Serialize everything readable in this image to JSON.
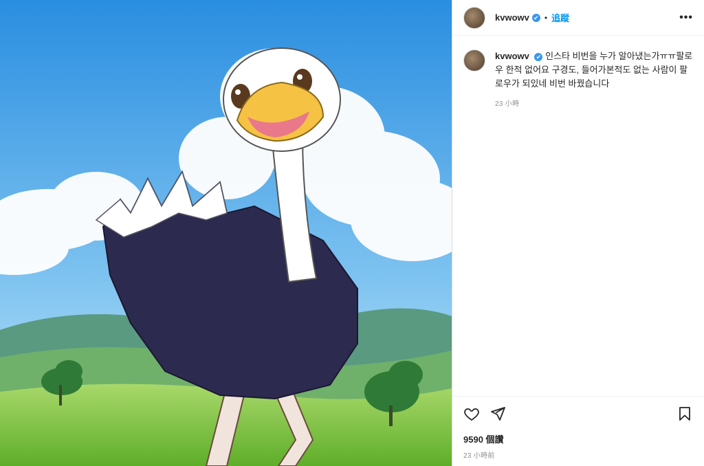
{
  "post": {
    "username": "kvwowv",
    "verified_mark": "✔",
    "follow_label": "追蹤",
    "more_label": "•••"
  },
  "caption": {
    "username": "kvwowv",
    "text": "인스타 비번을 누가 알아냈는가ㅠㅠ팔로우 한적 없어요 구경도, 들어가본적도 없는 사람이 팔로우가 되있네 비번 바꿨습니다",
    "time": "23 小時"
  },
  "footer": {
    "likes": "9590 個讚",
    "time_ago": "23 小時前"
  },
  "icons": {
    "like": "heart-icon",
    "share": "share-icon",
    "save": "bookmark-icon"
  }
}
